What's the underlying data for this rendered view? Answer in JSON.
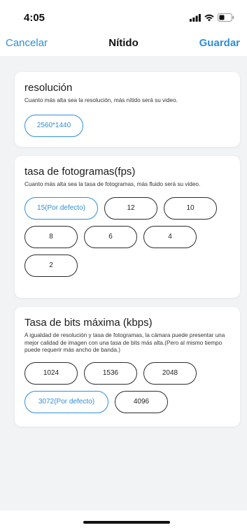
{
  "status_bar": {
    "time": "4:05"
  },
  "nav": {
    "cancel_label": "Cancelar",
    "title": "Nítido",
    "save_label": "Guardar"
  },
  "resolution": {
    "title": "resolución",
    "description": "Cuanto más alta sea la resolución, más nítido será su video.",
    "options": [
      {
        "label": "2560*1440",
        "selected": true
      }
    ]
  },
  "fps": {
    "title": "tasa de fotogramas(fps)",
    "description": "Cuanto más alta sea la tasa de fotogramas, más fluido será su video.",
    "options": [
      {
        "label": "15(Por defecto)",
        "selected": true
      },
      {
        "label": "12",
        "selected": false
      },
      {
        "label": "10",
        "selected": false
      },
      {
        "label": "8",
        "selected": false
      },
      {
        "label": "6",
        "selected": false
      },
      {
        "label": "4",
        "selected": false
      },
      {
        "label": "2",
        "selected": false
      }
    ]
  },
  "bitrate": {
    "title": "Tasa de bits máxima (kbps)",
    "description": "A igualdad de resolución y tasa de fotogramas, la cámara puede presentar una mejor calidad de imagen con una tasa de bits más alta.(Pero al mismo tiempo puede requerir más ancho de banda.)",
    "options": [
      {
        "label": "1024",
        "selected": false
      },
      {
        "label": "1536",
        "selected": false
      },
      {
        "label": "2048",
        "selected": false
      },
      {
        "label": "3072(Por defecto)",
        "selected": true
      },
      {
        "label": "4096",
        "selected": false
      }
    ]
  },
  "colors": {
    "accent": "#2f8ed6",
    "background": "#f2f3f5",
    "card": "#ffffff"
  }
}
